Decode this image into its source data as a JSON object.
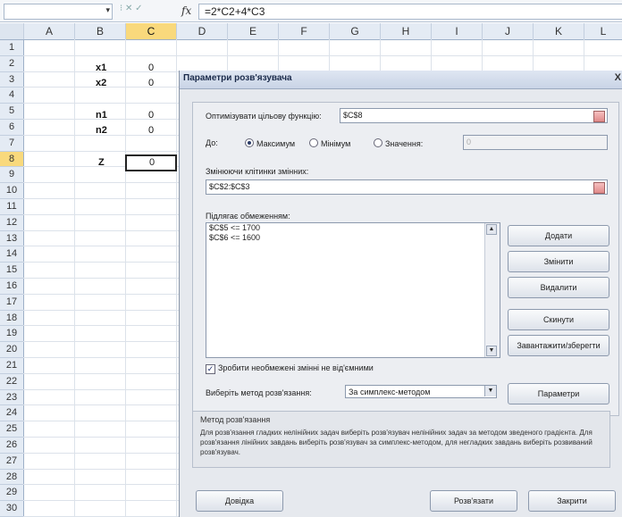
{
  "formula_bar": {
    "name_box": "",
    "fx": "fx",
    "formula": "=2*C2+4*C3"
  },
  "columns": [
    "A",
    "B",
    "C",
    "D",
    "E",
    "F",
    "G",
    "H",
    "I",
    "J",
    "K",
    "L"
  ],
  "rows": [
    "1",
    "2",
    "3",
    "4",
    "5",
    "6",
    "7",
    "8",
    "9",
    "10",
    "11",
    "12",
    "13",
    "14",
    "15",
    "16",
    "17",
    "18",
    "19",
    "20",
    "21",
    "22",
    "23",
    "24",
    "25",
    "26",
    "27",
    "28",
    "29",
    "30"
  ],
  "cells": {
    "b2": "x1",
    "c2": "0",
    "b3": "x2",
    "c3": "0",
    "b5": "n1",
    "c5": "0",
    "b6": "n2",
    "c6": "0",
    "b8": "Z",
    "c8": "0"
  },
  "dialog": {
    "title": "Параметри розв'язувача",
    "close": "X",
    "objective_label": "Оптимізувати цільову функцію:",
    "objective_value": "$C$8",
    "to_label": "До:",
    "radio_max": "Максимум",
    "radio_min": "Мінімум",
    "radio_value": "Значення:",
    "value_field": "0",
    "changing_label": "Змінюючи клітинки змінних:",
    "changing_value": "$C$2:$C$3",
    "constraints_label": "Підлягає обмеженням:",
    "constraints": [
      "$C$5 <= 1700",
      "$C$6 <= 1600"
    ],
    "btn_add": "Додати",
    "btn_change": "Змінити",
    "btn_delete": "Видалити",
    "btn_reset": "Скинути",
    "btn_load_save": "Завантажити/зберегти",
    "checkbox_label": "Зробити необмежені змінні не від'ємними",
    "method_label": "Виберіть метод розв'язання:",
    "method_value": "За симплекс-методом",
    "btn_params": "Параметри",
    "method_title": "Метод розв'язання",
    "method_text": "Для розв'язання гладких нелінійних задач виберіть розв'язувач нелінійних задач за методом зведеного градієнта. Для розв'язання лінійних завдань виберіть розв'язувач за симплекс-методом, для негладких завдань виберіть розвиваний розв'язувач.",
    "btn_help": "Довідка",
    "btn_solve": "Розв'язати",
    "btn_close": "Закрити"
  }
}
